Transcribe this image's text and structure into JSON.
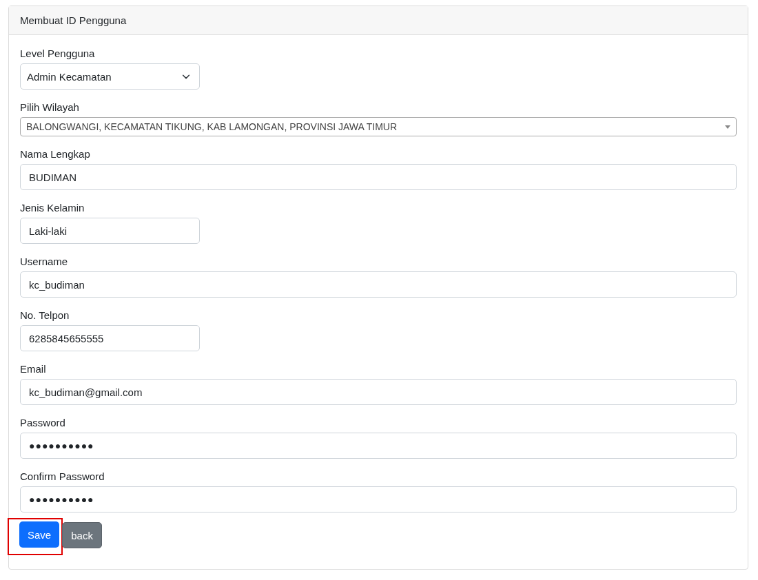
{
  "card": {
    "title": "Membuat ID Pengguna"
  },
  "fields": [
    {
      "label": "Level Pengguna",
      "kind": "dropdown",
      "short": true,
      "value": "Admin Kecamatan"
    },
    {
      "label": "Pilih Wilayah",
      "kind": "search-select",
      "short": false,
      "value": "BALONGWANGI, KECAMATAN TIKUNG, KAB LAMONGAN, PROVINSI JAWA TIMUR"
    },
    {
      "label": "Nama Lengkap",
      "kind": "text",
      "short": false,
      "value": "BUDIMAN"
    },
    {
      "label": "Jenis Kelamin",
      "kind": "text",
      "short": true,
      "value": "Laki-laki"
    },
    {
      "label": "Username",
      "kind": "text",
      "short": false,
      "value": "kc_budiman"
    },
    {
      "label": "No. Telpon",
      "kind": "text",
      "short": true,
      "value": "6285845655555"
    },
    {
      "label": "Email",
      "kind": "text",
      "short": false,
      "value": "kc_budiman@gmail.com"
    },
    {
      "label": "Password",
      "kind": "password",
      "short": false,
      "value": "●●●●●●●●●●"
    },
    {
      "label": "Confirm Password",
      "kind": "password",
      "short": false,
      "value": "●●●●●●●●●●"
    }
  ],
  "buttons": [
    {
      "label": "Save",
      "kind": "primary",
      "highlighted": true
    },
    {
      "label": "back",
      "kind": "secondary",
      "highlighted": false
    }
  ]
}
